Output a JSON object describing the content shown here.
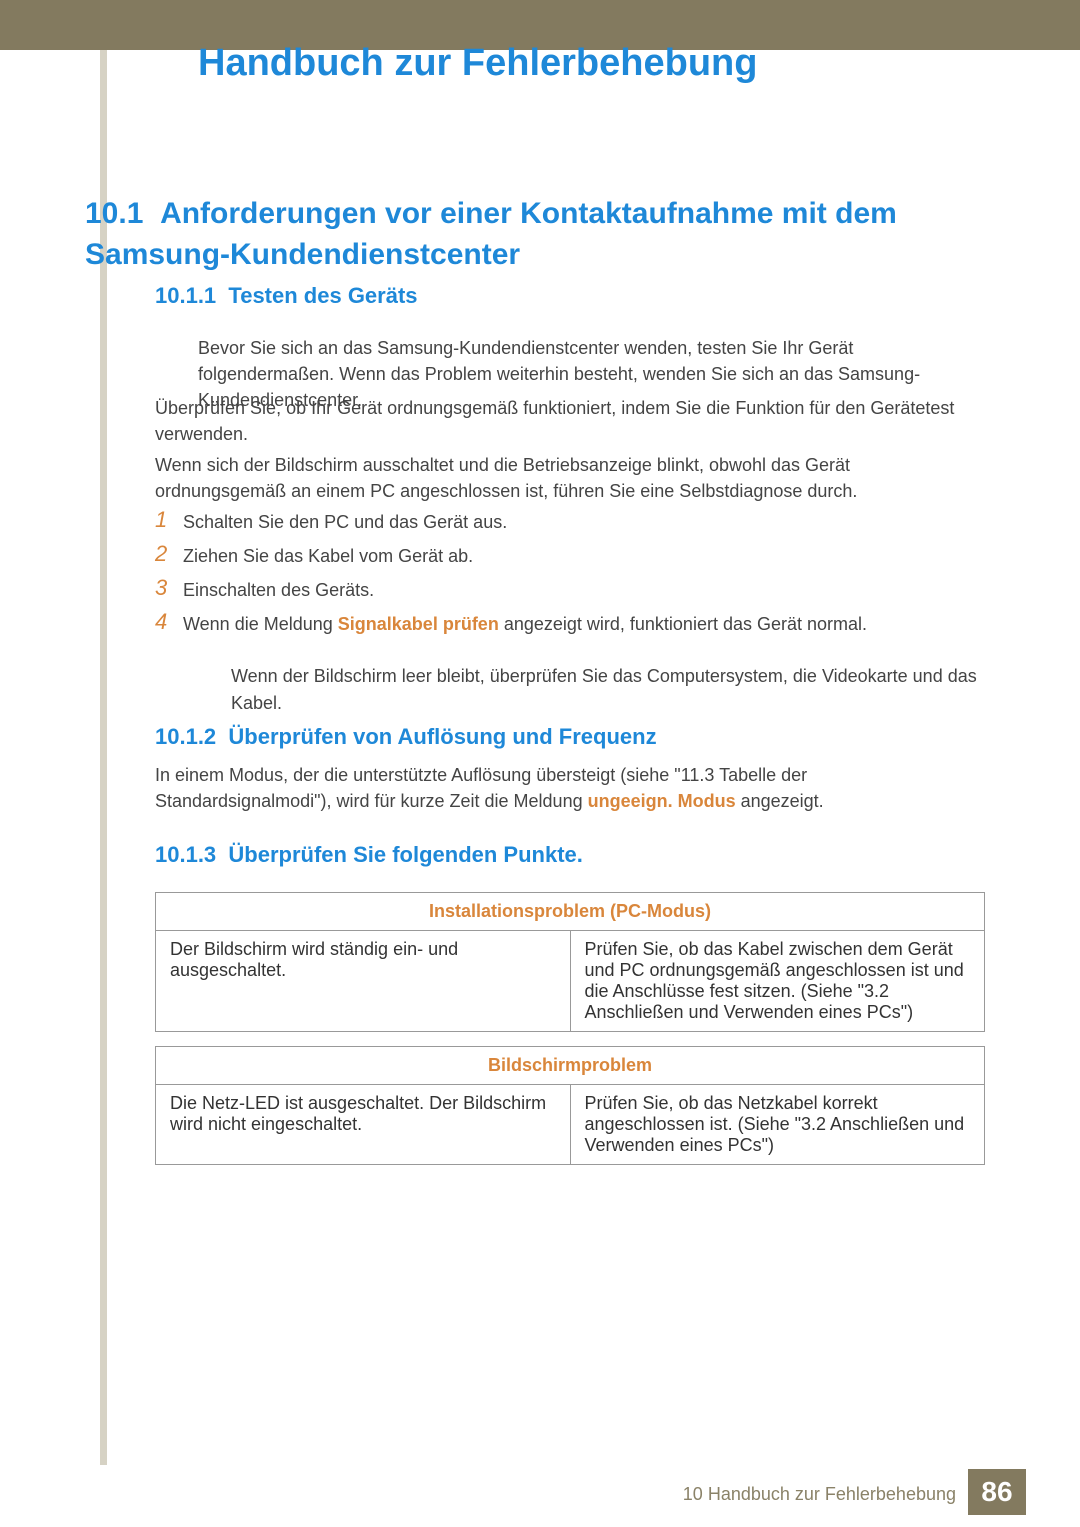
{
  "chapter": {
    "title": "Handbuch zur Fehlerbehebung"
  },
  "section": {
    "num": "10.1",
    "title": "Anforderungen vor einer Kontaktaufnahme mit dem Samsung-Kundendienstcenter"
  },
  "sub1": {
    "num": "10.1.1",
    "title": "Testen des Geräts",
    "p1": "Bevor Sie sich an das Samsung-Kundendienstcenter wenden, testen Sie Ihr Gerät folgendermaßen. Wenn das Problem weiterhin besteht, wenden Sie sich an das Samsung-Kundendienstcenter.",
    "p2": "Überprüfen Sie, ob Ihr Gerät ordnungsgemäß funktioniert, indem Sie die Funktion für den Gerätetest verwenden.",
    "p3": "Wenn sich der Bildschirm ausschaltet und die Betriebsanzeige blinkt, obwohl das Gerät ordnungsgemäß an einem PC angeschlossen ist, führen Sie eine Selbstdiagnose durch.",
    "steps": [
      "Schalten Sie den PC und das Gerät aus.",
      "Ziehen Sie das Kabel vom Gerät ab.",
      "Einschalten des Geräts."
    ],
    "step4_pre": "Wenn die Meldung ",
    "step4_bold": "Signalkabel prüfen",
    "step4_post": " angezeigt wird, funktioniert das Gerät normal.",
    "note": "Wenn der Bildschirm leer bleibt, überprüfen Sie das Computersystem, die Videokarte und das Kabel."
  },
  "sub2": {
    "num": "10.1.2",
    "title": "Überprüfen von Auflösung und Frequenz",
    "p_pre": "In einem Modus, der die unterstützte Auflösung übersteigt (siehe \"11.3 Tabelle der Standardsignalmodi\"), wird für kurze Zeit die Meldung ",
    "p_bold": "ungeeign. Modus",
    "p_post": " angezeigt."
  },
  "sub3": {
    "num": "10.1.3",
    "title": "Überprüfen Sie folgenden Punkte."
  },
  "table1": {
    "header": "Installationsproblem (PC-Modus)",
    "left": "Der Bildschirm wird ständig ein- und ausgeschaltet.",
    "right": "Prüfen Sie, ob das Kabel zwischen dem Gerät und PC ordnungsgemäß angeschlossen ist und die Anschlüsse fest sitzen. (Siehe \"3.2 Anschließen und Verwenden eines PCs\")"
  },
  "table2": {
    "header": "Bildschirmproblem",
    "left": "Die Netz-LED ist ausgeschaltet. Der Bildschirm wird nicht eingeschaltet.",
    "right": "Prüfen Sie, ob das Netzkabel korrekt angeschlossen ist. (Siehe \"3.2 Anschließen und Verwenden eines PCs\")"
  },
  "footer": {
    "label": "10 Handbuch zur Fehlerbehebung",
    "page": "86"
  }
}
